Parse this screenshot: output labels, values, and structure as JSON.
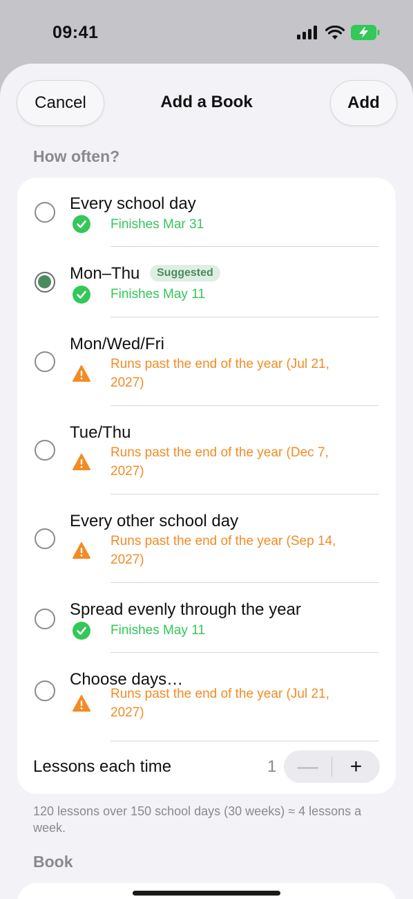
{
  "status_bar": {
    "time": "09:41"
  },
  "nav": {
    "cancel_label": "Cancel",
    "title": "Add a Book",
    "add_label": "Add"
  },
  "how_often": {
    "header": "How often?",
    "options": [
      {
        "title": "Every school day",
        "status": "ok",
        "status_text": "Finishes Mar 31",
        "selected": false
      },
      {
        "title": "Mon–Thu",
        "badge": "Suggested",
        "status": "ok",
        "status_text": "Finishes May 11",
        "selected": true
      },
      {
        "title": "Mon/Wed/Fri",
        "status": "warn",
        "status_text": "Runs past the end of the year (Jul 21, 2027)",
        "selected": false
      },
      {
        "title": "Tue/Thu",
        "status": "warn",
        "status_text": "Runs past the end of the year (Dec 7, 2027)",
        "selected": false
      },
      {
        "title": "Every other school day",
        "status": "warn",
        "status_text": "Runs past the end of the year (Sep 14, 2027)",
        "selected": false
      },
      {
        "title": "Spread evenly through the year",
        "status": "ok",
        "status_text": "Finishes May 11",
        "selected": false
      },
      {
        "title": "Choose days…",
        "status": "warn",
        "status_text": "Runs past the end of the year (Jul 21, 2027)",
        "selected": false
      }
    ]
  },
  "lessons": {
    "label": "Lessons each time",
    "value": "1",
    "minus": "—",
    "plus": "+"
  },
  "footnote": "120 lessons over 150 school days (30 weeks) ≈ 4 lessons a week.",
  "book_section": {
    "header": "Book"
  },
  "colors": {
    "accent_green": "#4b8a5e",
    "ok_green": "#34c759",
    "warn_orange": "#f28b24",
    "background": "#f2f2f7"
  },
  "icons": {
    "ok": "checkmark-circle-icon",
    "warn": "warning-triangle-icon"
  }
}
